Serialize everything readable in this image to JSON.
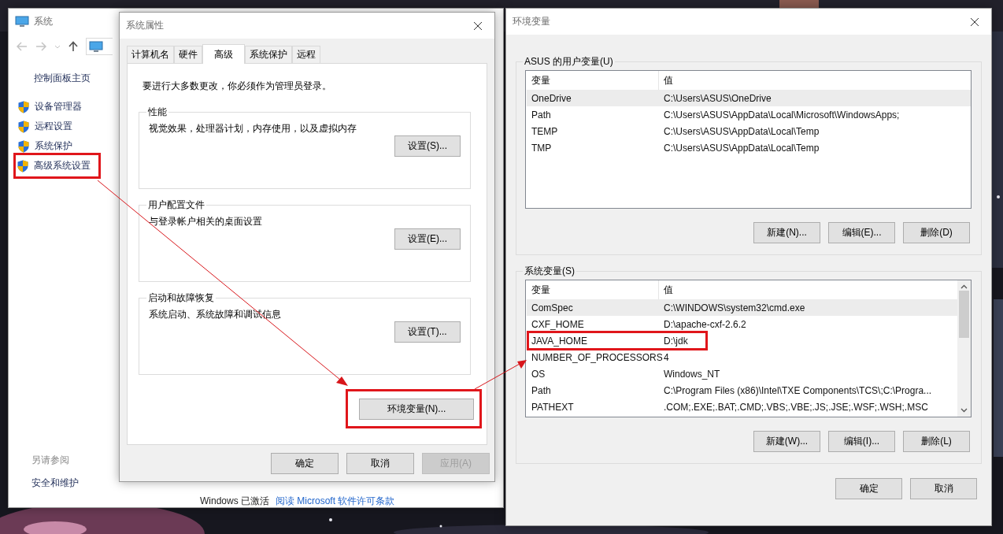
{
  "system_window": {
    "title": "系统",
    "nav_links": [
      {
        "label": "控制面板主页",
        "icon": false,
        "highlighted": false
      },
      {
        "label": "设备管理器",
        "icon": true,
        "highlighted": false
      },
      {
        "label": "远程设置",
        "icon": true,
        "highlighted": false
      },
      {
        "label": "系统保护",
        "icon": true,
        "highlighted": false
      },
      {
        "label": "高级系统设置",
        "icon": true,
        "highlighted": true
      }
    ],
    "see_also": {
      "heading": "另请参阅",
      "links": [
        "安全和维护"
      ]
    },
    "activation": {
      "status": "Windows 已激活",
      "link": "阅读 Microsoft 软件许可条款"
    }
  },
  "properties_dialog": {
    "title": "系统属性",
    "tabs": [
      {
        "label": "计算机名",
        "selected": false
      },
      {
        "label": "硬件",
        "selected": false
      },
      {
        "label": "高级",
        "selected": true
      },
      {
        "label": "系统保护",
        "selected": false
      },
      {
        "label": "远程",
        "selected": false
      }
    ],
    "notice": "要进行大多数更改，你必须作为管理员登录。",
    "groups": [
      {
        "title": "性能",
        "description": "视觉效果，处理器计划，内存使用，以及虚拟内存",
        "button": "设置(S)..."
      },
      {
        "title": "用户配置文件",
        "description": "与登录帐户相关的桌面设置",
        "button": "设置(E)..."
      },
      {
        "title": "启动和故障恢复",
        "description": "系统启动、系统故障和调试信息",
        "button": "设置(T)..."
      }
    ],
    "env_button": {
      "label": "环境变量(N)...",
      "highlighted": true
    },
    "buttons": [
      {
        "label": "确定",
        "disabled": false
      },
      {
        "label": "取消",
        "disabled": false
      },
      {
        "label": "应用(A)",
        "disabled": true
      }
    ]
  },
  "env_dialog": {
    "title": "环境变量",
    "user_vars": {
      "title": "ASUS 的用户变量(U)",
      "columns": [
        "变量",
        "值"
      ],
      "rows": [
        {
          "name": "OneDrive",
          "value": "C:\\Users\\ASUS\\OneDrive",
          "selected": true,
          "highlighted": false
        },
        {
          "name": "Path",
          "value": "C:\\Users\\ASUS\\AppData\\Local\\Microsoft\\WindowsApps;",
          "selected": false,
          "highlighted": false
        },
        {
          "name": "TEMP",
          "value": "C:\\Users\\ASUS\\AppData\\Local\\Temp",
          "selected": false,
          "highlighted": false
        },
        {
          "name": "TMP",
          "value": "C:\\Users\\ASUS\\AppData\\Local\\Temp",
          "selected": false,
          "highlighted": false
        }
      ],
      "buttons": [
        "新建(N)...",
        "编辑(E)...",
        "删除(D)"
      ]
    },
    "system_vars": {
      "title": "系统变量(S)",
      "columns": [
        "变量",
        "值"
      ],
      "rows": [
        {
          "name": "ComSpec",
          "value": "C:\\WINDOWS\\system32\\cmd.exe",
          "selected": true,
          "highlighted": false
        },
        {
          "name": "CXF_HOME",
          "value": "D:\\apache-cxf-2.6.2",
          "selected": false,
          "highlighted": false
        },
        {
          "name": "JAVA_HOME",
          "value": "D:\\jdk",
          "selected": false,
          "highlighted": true
        },
        {
          "name": "NUMBER_OF_PROCESSORS",
          "value": "4",
          "selected": false,
          "highlighted": false
        },
        {
          "name": "OS",
          "value": "Windows_NT",
          "selected": false,
          "highlighted": false
        },
        {
          "name": "Path",
          "value": "C:\\Program Files (x86)\\Intel\\TXE Components\\TCS\\;C:\\Progra...",
          "selected": false,
          "highlighted": false
        },
        {
          "name": "PATHEXT",
          "value": ".COM;.EXE;.BAT;.CMD;.VBS;.VBE;.JS;.JSE;.WSF;.WSH;.MSC",
          "selected": false,
          "highlighted": false
        }
      ],
      "buttons": [
        "新建(W)...",
        "编辑(I)...",
        "删除(L)"
      ]
    },
    "buttons": [
      "确定",
      "取消"
    ]
  }
}
